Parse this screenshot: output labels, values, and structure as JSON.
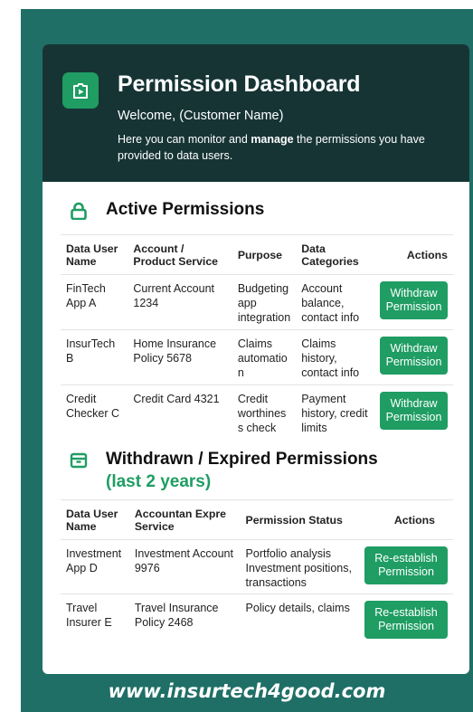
{
  "header": {
    "title": "Permission Dashboard",
    "welcome": "Welcome, (Customer Name)",
    "intro_part1": "Here you can monitor and ",
    "intro_bold": "manage",
    "intro_part2": " the permissions you have provided to data users."
  },
  "active": {
    "title": "Active Permissions",
    "columns": [
      "Data User Name",
      "Account / Product Service",
      "Purpose",
      "Data Categories",
      "Actions"
    ],
    "rows": [
      {
        "user": "FinTech App A",
        "account": "Current Account 1234",
        "purpose": "Budgeting app integration",
        "categories": "Account balance, contact info",
        "action": "Withdraw Permission"
      },
      {
        "user": "InsurTech B",
        "account": "Home Insurance Policy 5678",
        "purpose": "Claims automatio n",
        "categories": "Claims history, contact info",
        "action": "Withdraw Permission"
      },
      {
        "user": "Credit Checker C",
        "account": "Credit Card 4321",
        "purpose": "Credit worthines s check",
        "categories": "Payment history, credit limits",
        "action": "Withdraw Permission"
      }
    ]
  },
  "withdrawn": {
    "title": "Withdrawn / Expired Permissions",
    "subtitle": "(last 2 years)",
    "columns": [
      "Data User Name",
      "Accountan Expre Service",
      "Permission Status",
      "Actions"
    ],
    "rows": [
      {
        "user": "Investment App D",
        "account": "Investment Account 9976",
        "status": "Portfolio analysis Investment positions, transactions",
        "action": "Re-establish Permission"
      },
      {
        "user": "Travel Insurer E",
        "account": "Travel Insurance Policy 2468",
        "status": "Policy details, claims",
        "action": "Re-establish Permission"
      }
    ]
  },
  "footer": "www.insurtech4good.com",
  "colors": {
    "accent": "#1f9d63",
    "header_bg": "#173435",
    "frame_bg": "#1f6f67"
  },
  "icons": {
    "logo": "document-play-icon",
    "active": "lock-icon",
    "withdrawn": "archive-box-icon"
  }
}
